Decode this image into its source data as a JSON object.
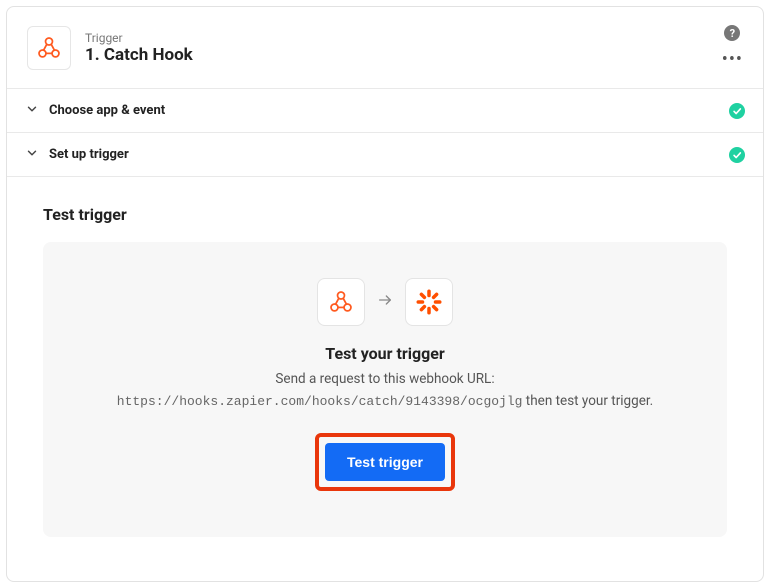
{
  "header": {
    "kicker": "Trigger",
    "title": "1. Catch Hook"
  },
  "sections": {
    "choose": "Choose app & event",
    "setup": "Set up trigger"
  },
  "panel": {
    "title": "Test trigger",
    "heading": "Test your trigger",
    "subtext": "Send a request to this webhook URL:",
    "url": "https://hooks.zapier.com/hooks/catch/9143398/ocgojlg",
    "url_suffix": " then test your trigger.",
    "button": "Test trigger"
  }
}
